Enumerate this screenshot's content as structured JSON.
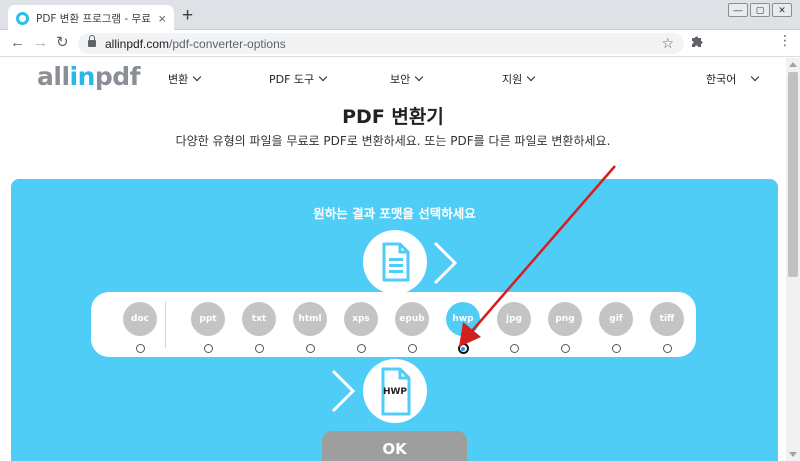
{
  "browser": {
    "tab_title": "PDF 변환 프로그램 - 무료 온라인",
    "tab_close": "×",
    "new_tab": "+",
    "window_controls": [
      "—",
      "▢",
      "✕"
    ],
    "nav": {
      "back": "←",
      "forward": "→",
      "reload": "↻"
    },
    "url_host": "allinpdf.com",
    "url_path": "/pdf-converter-options",
    "bookmark_icon": "star-icon",
    "extensions_icon": "puzzle-icon",
    "menu": "⋮"
  },
  "header": {
    "logo_prefix": "all",
    "logo_accent": "in",
    "logo_suffix": "pdf",
    "nav": [
      "변환",
      "PDF 도구",
      "보안",
      "지원"
    ],
    "language": "한국어"
  },
  "main": {
    "title": "PDF 변환기",
    "subtitle": "다양한 유형의 파일을 무료로 PDF로 변환하세요. 또는 PDF를 다른 파일로 변환하세요.",
    "panel_heading": "원하는 결과 포맷을 선택하세요",
    "source_icon": "document-icon",
    "target_label": "HWP",
    "formats": [
      "doc",
      "ppt",
      "txt",
      "html",
      "xps",
      "epub",
      "hwp",
      "jpg",
      "png",
      "gif",
      "tiff"
    ],
    "selected_format": "hwp",
    "ok_label": "OK"
  },
  "colors": {
    "accent": "#4fcdf7",
    "logo_accent": "#25b9e6",
    "format_inactive": "#c4c4c4",
    "ok_button": "#9e9e9e",
    "annotation_arrow": "#d21f1f"
  }
}
